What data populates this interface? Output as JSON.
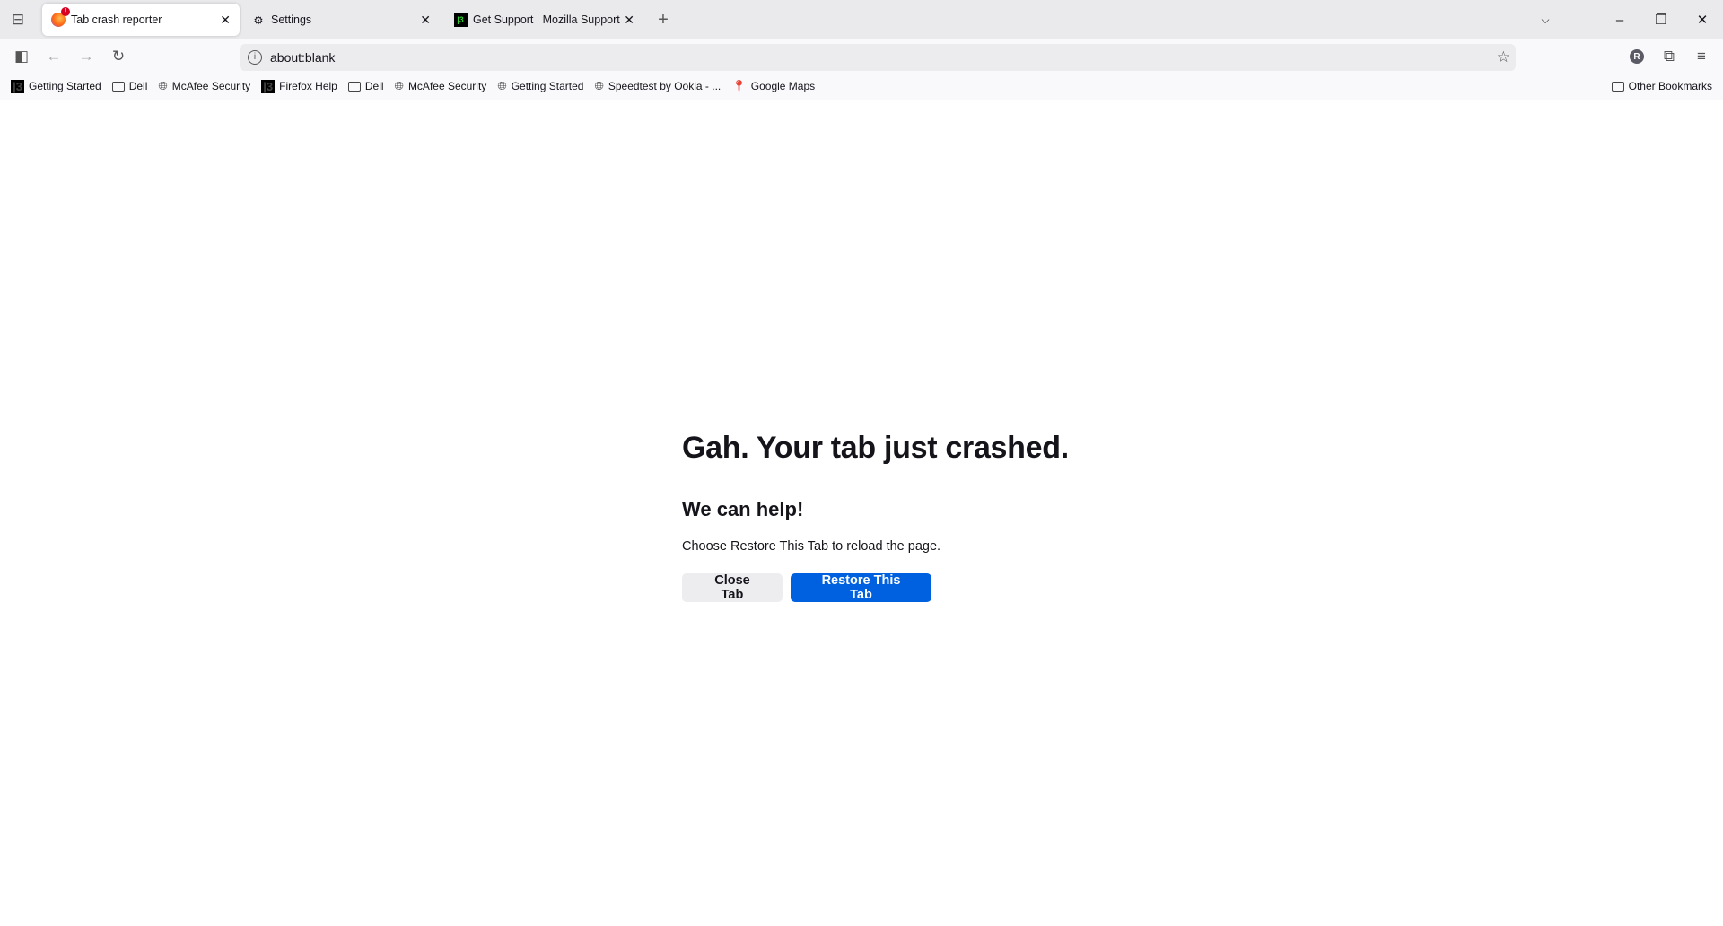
{
  "tabs": [
    {
      "label": "Tab crash reporter",
      "icon": "firefox-crash-icon",
      "active": true
    },
    {
      "label": "Settings",
      "icon": "gear-icon",
      "active": false
    },
    {
      "label": "Get Support | Mozilla Support",
      "icon": "mozilla-support-icon",
      "active": false
    }
  ],
  "toolbar": {
    "url": "about:blank",
    "profile_initial": "R"
  },
  "bookmarks": [
    {
      "label": "Getting Started",
      "icon": "mozilla-icon"
    },
    {
      "label": "Dell",
      "icon": "folder-icon"
    },
    {
      "label": "McAfee Security",
      "icon": "globe-icon"
    },
    {
      "label": "Firefox Help",
      "icon": "mozilla-icon"
    },
    {
      "label": "Dell",
      "icon": "folder-icon"
    },
    {
      "label": "McAfee Security",
      "icon": "globe-icon"
    },
    {
      "label": "Getting Started",
      "icon": "globe-icon"
    },
    {
      "label": "Speedtest by Ookla - ...",
      "icon": "globe-icon"
    },
    {
      "label": "Google Maps",
      "icon": "map-pin-icon"
    }
  ],
  "other_bookmarks": "Other Bookmarks",
  "page": {
    "title": "Gah. Your tab just crashed.",
    "subtitle": "We can help!",
    "message": "Choose Restore This Tab to reload the page.",
    "close_label": "Close Tab",
    "restore_label": "Restore This Tab",
    "accent": "#0061e0"
  }
}
